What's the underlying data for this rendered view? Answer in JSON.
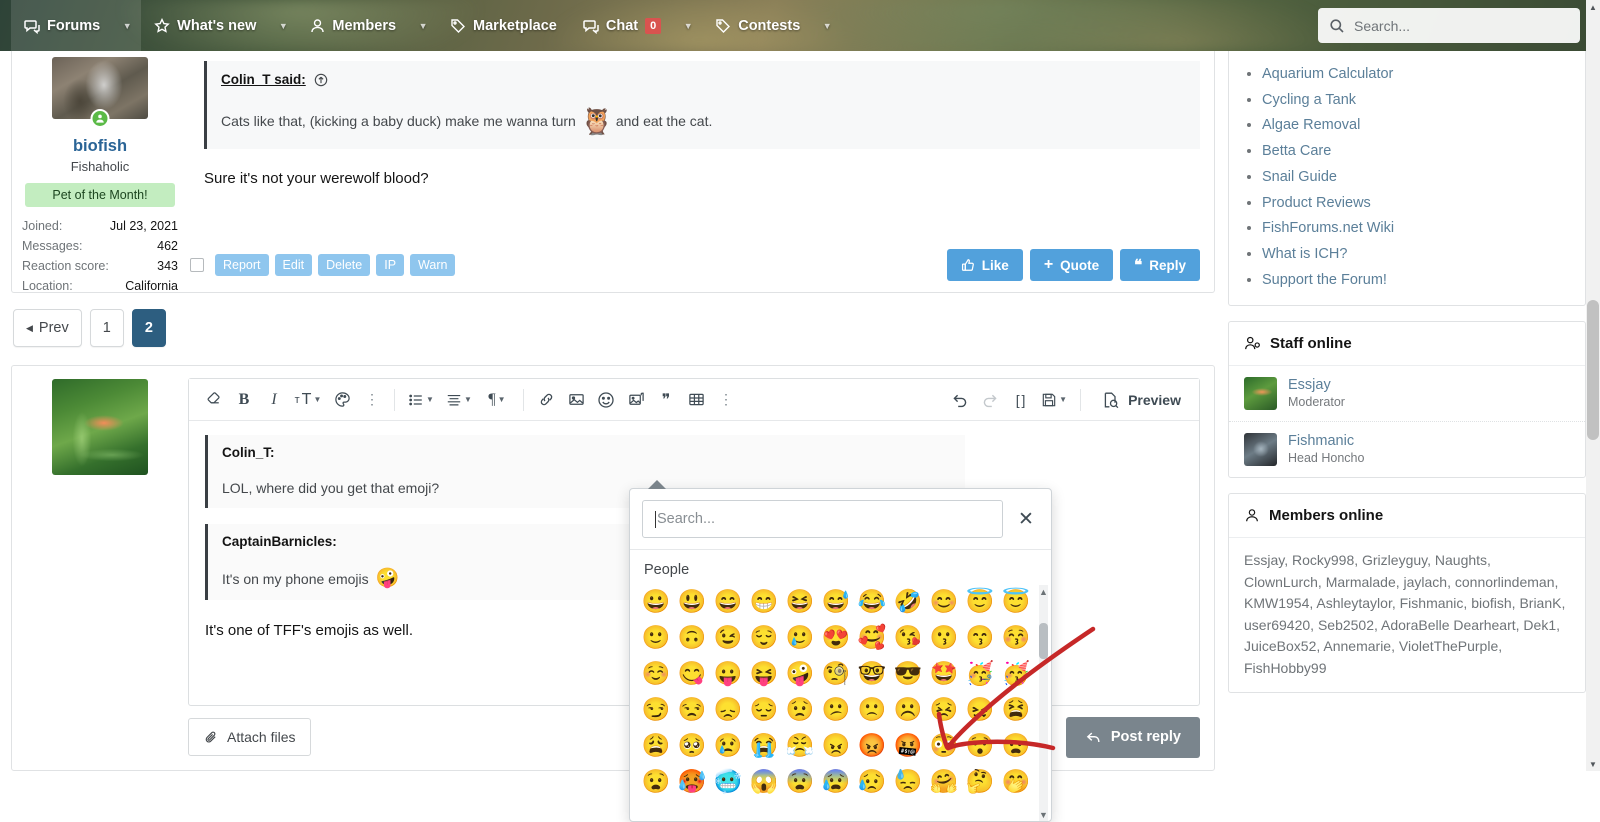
{
  "header": {
    "nav": [
      {
        "label": "Forums",
        "icon": "forums-icon",
        "caret": true,
        "active": true
      },
      {
        "label": "What's new",
        "icon": "star-icon",
        "caret": true,
        "active": false
      },
      {
        "label": "Members",
        "icon": "person-icon",
        "caret": true,
        "active": false
      },
      {
        "label": "Marketplace",
        "icon": "tag-icon",
        "caret": false,
        "active": false
      },
      {
        "label": "Chat",
        "icon": "chat-icon",
        "caret": true,
        "active": false,
        "badge": "0"
      },
      {
        "label": "Contests",
        "icon": "tag-icon",
        "caret": true,
        "active": false
      }
    ],
    "search_placeholder": "Search..."
  },
  "post": {
    "user": {
      "username": "biofish",
      "title": "Fishaholic",
      "banner": "Pet of the Month!",
      "stats": [
        {
          "key": "Joined:",
          "value": "Jul 23, 2021"
        },
        {
          "key": "Messages:",
          "value": "462"
        },
        {
          "key": "Reaction score:",
          "value": "343"
        },
        {
          "key": "Location:",
          "value": "California"
        }
      ]
    },
    "quote": {
      "author": "Colin_T said:",
      "text_before": "Cats like that, (kicking a baby duck) make me wanna turn",
      "emoji": "🦉",
      "text_after": "and eat the cat."
    },
    "body": "Sure it's not your werewolf blood?",
    "mod_buttons": [
      "Report",
      "Edit",
      "Delete",
      "IP",
      "Warn"
    ],
    "actions": [
      {
        "label": "Like",
        "icon": "thumbs-up-icon"
      },
      {
        "label": "Quote",
        "icon": "plus-icon"
      },
      {
        "label": "Reply",
        "icon": "quote-icon"
      }
    ]
  },
  "pagination": {
    "prev_label": "Prev",
    "pages": [
      "1",
      "2"
    ],
    "active_page": "2"
  },
  "editor": {
    "toolbar_left": [
      {
        "name": "remove-formatting-icon",
        "glyph": "◇"
      },
      {
        "name": "bold-icon",
        "glyph": "B"
      },
      {
        "name": "italic-icon",
        "glyph": "I"
      },
      {
        "name": "font-size-icon",
        "glyph": "ᴛT"
      },
      {
        "name": "text-color-icon",
        "glyph": "◑"
      },
      {
        "name": "more-inline-icon",
        "glyph": "⋮"
      }
    ],
    "toolbar_mid": [
      {
        "name": "list-icon",
        "glyph": "≡"
      },
      {
        "name": "align-icon",
        "glyph": "≣"
      },
      {
        "name": "paragraph-icon",
        "glyph": "¶"
      }
    ],
    "toolbar_insert": [
      {
        "name": "link-icon",
        "glyph": "🔗"
      },
      {
        "name": "image-icon",
        "glyph": "▣"
      },
      {
        "name": "emoji-icon",
        "glyph": "☺"
      },
      {
        "name": "media-icon",
        "glyph": "▤"
      },
      {
        "name": "quote-icon",
        "glyph": "❝"
      },
      {
        "name": "table-icon",
        "glyph": "⊞"
      },
      {
        "name": "more-tools-icon",
        "glyph": "⋮"
      }
    ],
    "toolbar_right": [
      {
        "name": "undo-icon",
        "glyph": "↶"
      },
      {
        "name": "redo-icon",
        "glyph": "↷"
      },
      {
        "name": "bbcode-icon",
        "glyph": "[ ]"
      },
      {
        "name": "draft-icon",
        "glyph": "💾"
      }
    ],
    "preview_label": "Preview",
    "quotes": [
      {
        "author": "Colin_T:",
        "text": "LOL, where did you get that emoji?",
        "emoji": ""
      },
      {
        "author": "CaptainBarnicles:",
        "text": "It's on my phone emojis",
        "emoji": "🤪"
      }
    ],
    "body": "It's one of TFF's emojis as well.",
    "attach_label": "Attach files",
    "post_reply_label": "Post reply"
  },
  "emoji_picker": {
    "search_placeholder": "Search...",
    "close_label": "✕",
    "category": "People",
    "rows": [
      [
        "😀",
        "😃",
        "😄",
        "😁",
        "😆",
        "😅",
        "😂",
        "🤣",
        "😊",
        "😇",
        "😇"
      ],
      [
        "🙂",
        "🙃",
        "😉",
        "😌",
        "🥲",
        "😍",
        "🥰",
        "😘",
        "😗",
        "😙",
        "😚"
      ],
      [
        "☺️",
        "😋",
        "😛",
        "😝",
        "🤪",
        "🧐",
        "🤓",
        "😎",
        "🤩",
        "🥳",
        "🥳"
      ],
      [
        "😏",
        "😒",
        "😞",
        "😔",
        "😟",
        "😕",
        "🙁",
        "☹️",
        "😣",
        "😖",
        "😫"
      ],
      [
        "😩",
        "🥺",
        "😢",
        "😭",
        "😤",
        "😠",
        "😡",
        "🤬",
        "😳",
        "😯",
        "😦"
      ],
      [
        "😧",
        "🥵",
        "🥶",
        "😱",
        "😨",
        "😰",
        "😥",
        "😓",
        "🤗",
        "🤔",
        "🤭"
      ]
    ]
  },
  "sidebar": {
    "resources": [
      "Aquarium Calculator",
      "Cycling a Tank",
      "Algae Removal",
      "Betta Care",
      "Snail Guide",
      "Product Reviews",
      "FishForums.net Wiki",
      "What is ICH?",
      "Support the Forum!"
    ],
    "staff": {
      "title": "Staff online",
      "members": [
        {
          "name": "Essjay",
          "role": "Moderator"
        },
        {
          "name": "Fishmanic",
          "role": "Head Honcho"
        }
      ]
    },
    "members_online": {
      "title": "Members online",
      "names": "Essjay, Rocky998, Grizleyguy, Naughts, ClownLurch, Marmalade, jaylach, connorlindeman, KMW1954, Ashleytaylor, Fishmanic, biofish, BrianK, user69420, Seb2502, AdoraBelle Dearheart, Dek1, JuiceBox52, Annemarie, VioletThePurple, FishHobby99"
    }
  },
  "annotation": {
    "color": "#cc2222",
    "description": "hand-drawn arrow pointing to cursing emoji"
  }
}
